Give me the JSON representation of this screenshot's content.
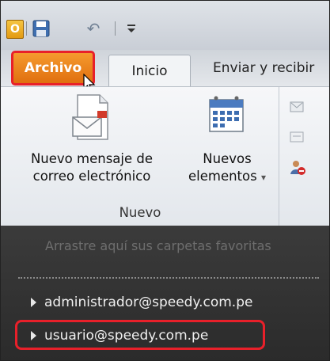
{
  "qat": {
    "app_icon_letter": "O",
    "items": [
      "outlook-icon",
      "save-icon",
      "undo-icon",
      "customize-dropdown"
    ]
  },
  "tabs": {
    "archivo": "Archivo",
    "inicio": "Inicio",
    "enviar": "Enviar y recibir"
  },
  "ribbon": {
    "new_email_line1": "Nuevo mensaje de",
    "new_email_line2": "correo electrónico",
    "new_items_line1": "Nuevos",
    "new_items_line2": "elementos",
    "new_items_arrow": "▾",
    "group_label": "Nuevo"
  },
  "nav": {
    "favorites_hint": "Arrastre aquí sus carpetas favoritas",
    "accounts": [
      "administrador@speedy.com.pe",
      "usuario@speedy.com.pe"
    ]
  },
  "colors": {
    "archivo_tab": "#e67a18",
    "highlight_border": "#e8202a",
    "nav_background": "#2e2e2e"
  }
}
